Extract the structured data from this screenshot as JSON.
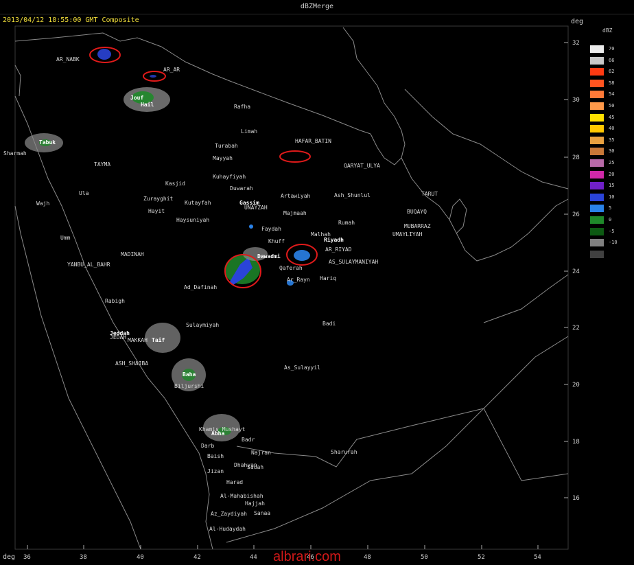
{
  "window": {
    "title": "dBZMerge"
  },
  "timestamp": "2013/04/12 18:55:00 GMT Composite",
  "axis": {
    "lat_unit": "deg",
    "lon_unit": "deg",
    "lat_ticks": [
      "32",
      "30",
      "28",
      "26",
      "24",
      "22",
      "20",
      "18",
      "16"
    ],
    "lon_ticks": [
      "36",
      "38",
      "40",
      "42",
      "44",
      "46",
      "48",
      "50",
      "52",
      "54"
    ]
  },
  "legend": {
    "unit": "dBZ",
    "entries": [
      {
        "label": "70",
        "color": "#ececec"
      },
      {
        "label": "66",
        "color": "#c8c8c8"
      },
      {
        "label": "62",
        "color": "#ff3a12"
      },
      {
        "label": "58",
        "color": "#ff5420"
      },
      {
        "label": "54",
        "color": "#ff7a38"
      },
      {
        "label": "50",
        "color": "#ff9a4a"
      },
      {
        "label": "45",
        "color": "#ffe000"
      },
      {
        "label": "40",
        "color": "#ffc800"
      },
      {
        "label": "35",
        "color": "#e8a040"
      },
      {
        "label": "30",
        "color": "#c87838"
      },
      {
        "label": "25",
        "color": "#b86aa8"
      },
      {
        "label": "20",
        "color": "#d028a8"
      },
      {
        "label": "15",
        "color": "#7020c8"
      },
      {
        "label": "10",
        "color": "#2a44d8"
      },
      {
        "label": "5",
        "color": "#2a82e8"
      },
      {
        "label": "0",
        "color": "#1f8a2a"
      },
      {
        "label": "-5",
        "color": "#0c5a12"
      },
      {
        "label": "-10",
        "color": "#808080"
      },
      {
        "label": "",
        "color": "#404040"
      }
    ]
  },
  "cities": [
    {
      "name": "AR_NABK",
      "bold": false
    },
    {
      "name": "AR_AR",
      "bold": false
    },
    {
      "name": "Rafha",
      "bold": false
    },
    {
      "name": "Limah",
      "bold": false
    },
    {
      "name": "HAFAR_BATIN",
      "bold": false
    },
    {
      "name": "Turabah",
      "bold": false
    },
    {
      "name": "Mayyah",
      "bold": false
    },
    {
      "name": "QARYAT_ULYA",
      "bold": false
    },
    {
      "name": "TAYMA",
      "bold": false
    },
    {
      "name": "Kuhayfiyah",
      "bold": false
    },
    {
      "name": "Kasjid",
      "bold": false
    },
    {
      "name": "Duwarah",
      "bold": false
    },
    {
      "name": "Ula",
      "bold": false
    },
    {
      "name": "Zurayghit",
      "bold": false
    },
    {
      "name": "Kutayfah",
      "bold": false
    },
    {
      "name": "Artawiyah",
      "bold": false
    },
    {
      "name": "Ash_Shunlul",
      "bold": false
    },
    {
      "name": "TARUT",
      "bold": false
    },
    {
      "name": "Wajh",
      "bold": false
    },
    {
      "name": "Hayit",
      "bold": false
    },
    {
      "name": "Haysuniyah",
      "bold": false
    },
    {
      "name": "UNAYZAH",
      "bold": false
    },
    {
      "name": "Majmaah",
      "bold": false
    },
    {
      "name": "BUQAYQ",
      "bold": false
    },
    {
      "name": "Rumah",
      "bold": false
    },
    {
      "name": "MUBARRAZ",
      "bold": false
    },
    {
      "name": "Faydah",
      "bold": false
    },
    {
      "name": "UMAYLIYAH",
      "bold": false
    },
    {
      "name": "Umm",
      "bold": false
    },
    {
      "name": "Malhah",
      "bold": false
    },
    {
      "name": "Khuff",
      "bold": false
    },
    {
      "name": "Riyadh",
      "bold": true
    },
    {
      "name": "MADINAH",
      "bold": false
    },
    {
      "name": "AR_RIYAD",
      "bold": false
    },
    {
      "name": "YANBU_AL_BAHR",
      "bold": false
    },
    {
      "name": "Dawadmi",
      "bold": true
    },
    {
      "name": "AS_SULAYMANIYAH",
      "bold": false
    },
    {
      "name": "Qaferah",
      "bold": false
    },
    {
      "name": "Ar_Rayn",
      "bold": false
    },
    {
      "name": "Hariq",
      "bold": false
    },
    {
      "name": "Ad_Dafinah",
      "bold": false
    },
    {
      "name": "Rabigh",
      "bold": false
    },
    {
      "name": "Badi",
      "bold": false
    },
    {
      "name": "Sulaymiyah",
      "bold": false
    },
    {
      "name": "Jeddah",
      "bold": true
    },
    {
      "name": "JEDAH",
      "bold": false
    },
    {
      "name": "MAKKAH",
      "bold": false
    },
    {
      "name": "Taif",
      "bold": true
    },
    {
      "name": "ASH_SHAIBA",
      "bold": false
    },
    {
      "name": "As_Sulayyil",
      "bold": false
    },
    {
      "name": "Baha",
      "bold": true
    },
    {
      "name": "Biljurshi",
      "bold": false
    },
    {
      "name": "Khamis Mushayt",
      "bold": false
    },
    {
      "name": "Abha",
      "bold": true
    },
    {
      "name": "Badr",
      "bold": false
    },
    {
      "name": "Darb",
      "bold": false
    },
    {
      "name": "Najran",
      "bold": false
    },
    {
      "name": "Sharurah",
      "bold": false
    },
    {
      "name": "Baish",
      "bold": false
    },
    {
      "name": "Dhahyan",
      "bold": false
    },
    {
      "name": "Sadah",
      "bold": false
    },
    {
      "name": "Jizan",
      "bold": false
    },
    {
      "name": "Harad",
      "bold": false
    },
    {
      "name": "Al-Mahabishah",
      "bold": false
    },
    {
      "name": "Hajjah",
      "bold": false
    },
    {
      "name": "Az_Zaydiyah",
      "bold": false
    },
    {
      "name": "Sanaa",
      "bold": false
    },
    {
      "name": "Al-Hudaydah",
      "bold": false
    },
    {
      "name": "Tabuk",
      "bold": true
    },
    {
      "name": "Hail",
      "bold": true
    },
    {
      "name": "Gassim",
      "bold": true
    },
    {
      "name": "Sharmah",
      "bold": false
    },
    {
      "name": "Jouf",
      "bold": true
    }
  ],
  "watermark": "albrari.com"
}
